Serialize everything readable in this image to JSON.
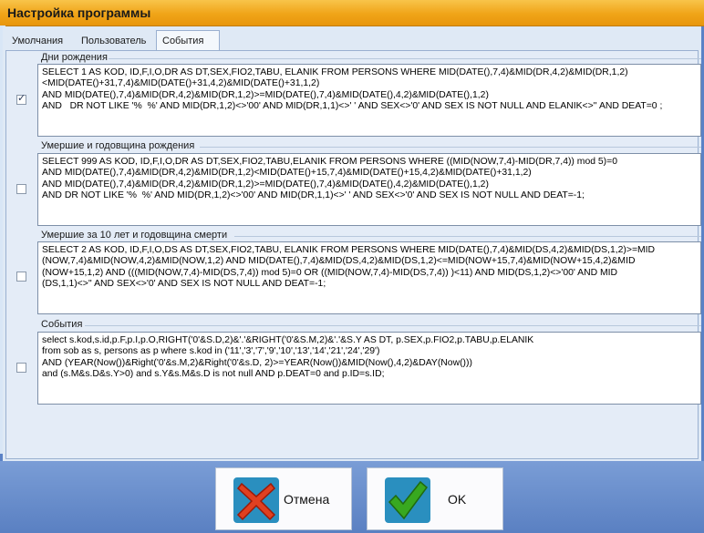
{
  "window": {
    "title": "Настройка программы"
  },
  "tabs": [
    {
      "label": "Умолчания",
      "active": false
    },
    {
      "label": "Пользователь",
      "active": false
    },
    {
      "label": "События",
      "active": true
    }
  ],
  "groups": [
    {
      "label": "Дни рождения",
      "checked": true,
      "sql": "SELECT 1 AS KOD, ID,F,I,O,DR AS DT,SEX,FIO2,TABU, ELANIK FROM PERSONS WHERE MID(DATE(),7,4)&MID(DR,4,2)&MID(DR,1,2)<MID(DATE()+31,7,4)&MID(DATE()+31,4,2)&MID(DATE()+31,1,2)\nAND MID(DATE(),7,4)&MID(DR,4,2)&MID(DR,1,2)>=MID(DATE(),7,4)&MID(DATE(),4,2)&MID(DATE(),1,2)\nAND   DR NOT LIKE '%  %' AND MID(DR,1,2)<>'00' AND MID(DR,1,1)<>' ' AND SEX<>'0' AND SEX IS NOT NULL AND ELANIK<>'' AND DEAT=0 ;"
    },
    {
      "label": "Умершие и годовщина рождения",
      "checked": false,
      "sql": "SELECT 999 AS KOD, ID,F,I,O,DR AS DT,SEX,FIO2,TABU,ELANIK FROM PERSONS WHERE ((MID(NOW,7,4)-MID(DR,7,4)) mod 5)=0\nAND MID(DATE(),7,4)&MID(DR,4,2)&MID(DR,1,2)<MID(DATE()+15,7,4)&MID(DATE()+15,4,2)&MID(DATE()+31,1,2)\nAND MID(DATE(),7,4)&MID(DR,4,2)&MID(DR,1,2)>=MID(DATE(),7,4)&MID(DATE(),4,2)&MID(DATE(),1,2)\nAND DR NOT LIKE '%  %' AND MID(DR,1,2)<>'00' AND MID(DR,1,1)<>' ' AND SEX<>'0' AND SEX IS NOT NULL AND DEAT=-1;"
    },
    {
      "label": "Умершие за 10 лет и годовщина смерти",
      "checked": false,
      "sql": "SELECT 2 AS KOD, ID,F,I,O,DS AS DT,SEX,FIO2,TABU, ELANIK FROM PERSONS WHERE MID(DATE(),7,4)&MID(DS,4,2)&MID(DS,1,2)>=MID\n(NOW,7,4)&MID(NOW,4,2)&MID(NOW,1,2) AND MID(DATE(),7,4)&MID(DS,4,2)&MID(DS,1,2)<=MID(NOW+15,7,4)&MID(NOW+15,4,2)&MID\n(NOW+15,1,2) AND (((MID(NOW,7,4)-MID(DS,7,4)) mod 5)=0 OR ((MID(NOW,7,4)-MID(DS,7,4)) )<11) AND MID(DS,1,2)<>'00' AND MID\n(DS,1,1)<>'' AND SEX<>'0' AND SEX IS NOT NULL AND DEAT=-1;"
    },
    {
      "label": "События",
      "checked": false,
      "sql": "select s.kod,s.id,p.F,p.I,p.O,RIGHT('0'&S.D,2)&'.'&RIGHT('0'&S.M,2)&'.'&S.Y AS DT, p.SEX,p.FIO2,p.TABU,p.ELANIK\nfrom sob as s, persons as p where s.kod in ('11','3','7','9','10','13','14','21','24','29')\nAND (YEAR(Now())&Right('0'&s.M,2)&Right('0'&s.D, 2)>=YEAR(Now())&MID(Now(),4,2)&DAY(Now()))\nand (s.M&s.D&s.Y>0) and s.Y&s.M&s.D is not null AND p.DEAT=0 and p.ID=s.ID;"
    }
  ],
  "buttons": {
    "cancel_label": "Отмена",
    "ok_label": "OK"
  },
  "colors": {
    "title_bar": "#f0a418",
    "dialog_bg": "#dfe9f5",
    "footer_bg": "#5a80c2",
    "cancel_icon": "#e04020",
    "ok_icon": "#38a820"
  },
  "icons": {
    "cancel": "red-x-icon",
    "ok": "green-check-icon"
  }
}
